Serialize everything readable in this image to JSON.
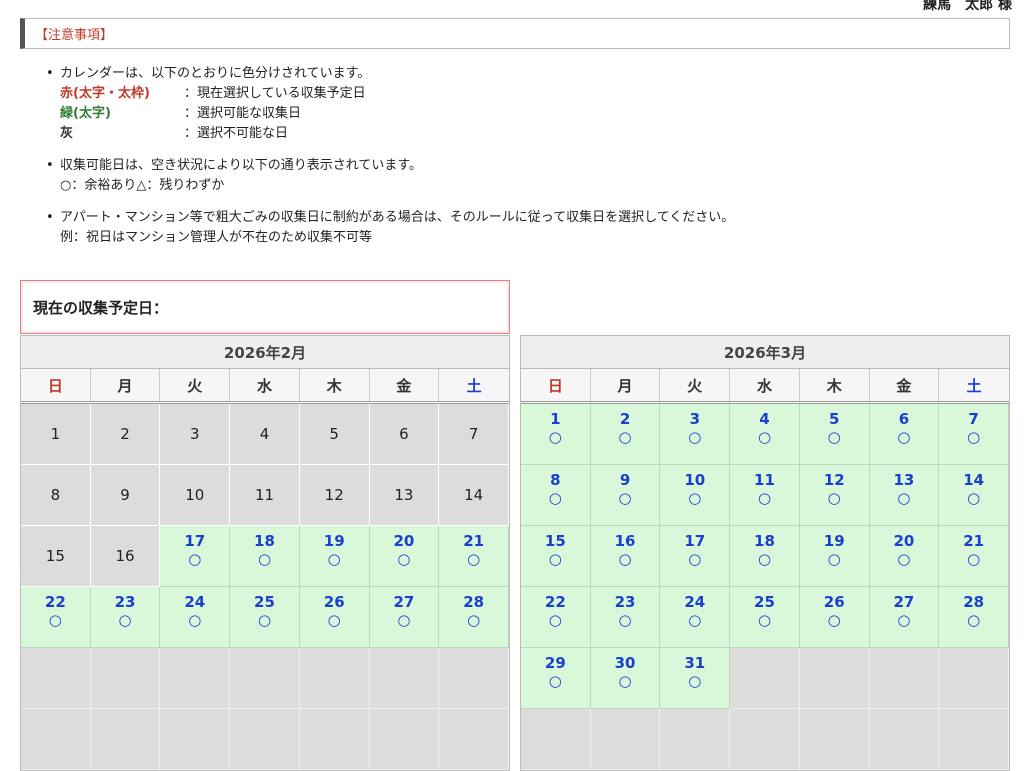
{
  "header": {
    "user_name": "練馬　太郎 様"
  },
  "notice": {
    "title": "【注意事項】"
  },
  "notes": {
    "item1": "カレンダーは、以下のとおりに色分けされています。",
    "legend": [
      {
        "term": "赤(太字・太枠)",
        "desc": "：現在選択している収集予定日",
        "color": "#c0392b"
      },
      {
        "term": "緑(太字)",
        "desc": "：選択可能な収集日",
        "color": "#2e7d32"
      },
      {
        "term": "灰",
        "desc": "：選択不可能な日",
        "color": "#333333"
      }
    ],
    "item2": "収集可能日は、空き状況により以下の通り表示されています。",
    "item2_sub": "○：余裕あり△：残りわずか",
    "item3": "アパート・マンション等で粗大ごみの収集日に制約がある場合は、そのルールに従って収集日を選択してください。",
    "item3_sub": "例：祝日はマンション管理人が不在のため収集不可等"
  },
  "current": {
    "label": "現在の収集予定日："
  },
  "weekdays": [
    "日",
    "月",
    "火",
    "水",
    "木",
    "金",
    "土"
  ],
  "availability_mark": "○",
  "calendars": [
    {
      "title": "2026年2月",
      "start_offset": 0,
      "days": 28,
      "available_from": 17,
      "rows_shown": 6
    },
    {
      "title": "2026年3月",
      "start_offset": 0,
      "days": 31,
      "available_from": 1,
      "rows_shown": 6
    }
  ],
  "colors": {
    "available_bg": "#d9f7d9",
    "unavailable_bg": "#dcdcdc",
    "date_blue": "#1a3fd1",
    "sunday_red": "#c0392b",
    "saturday_blue": "#1a3fd1"
  }
}
